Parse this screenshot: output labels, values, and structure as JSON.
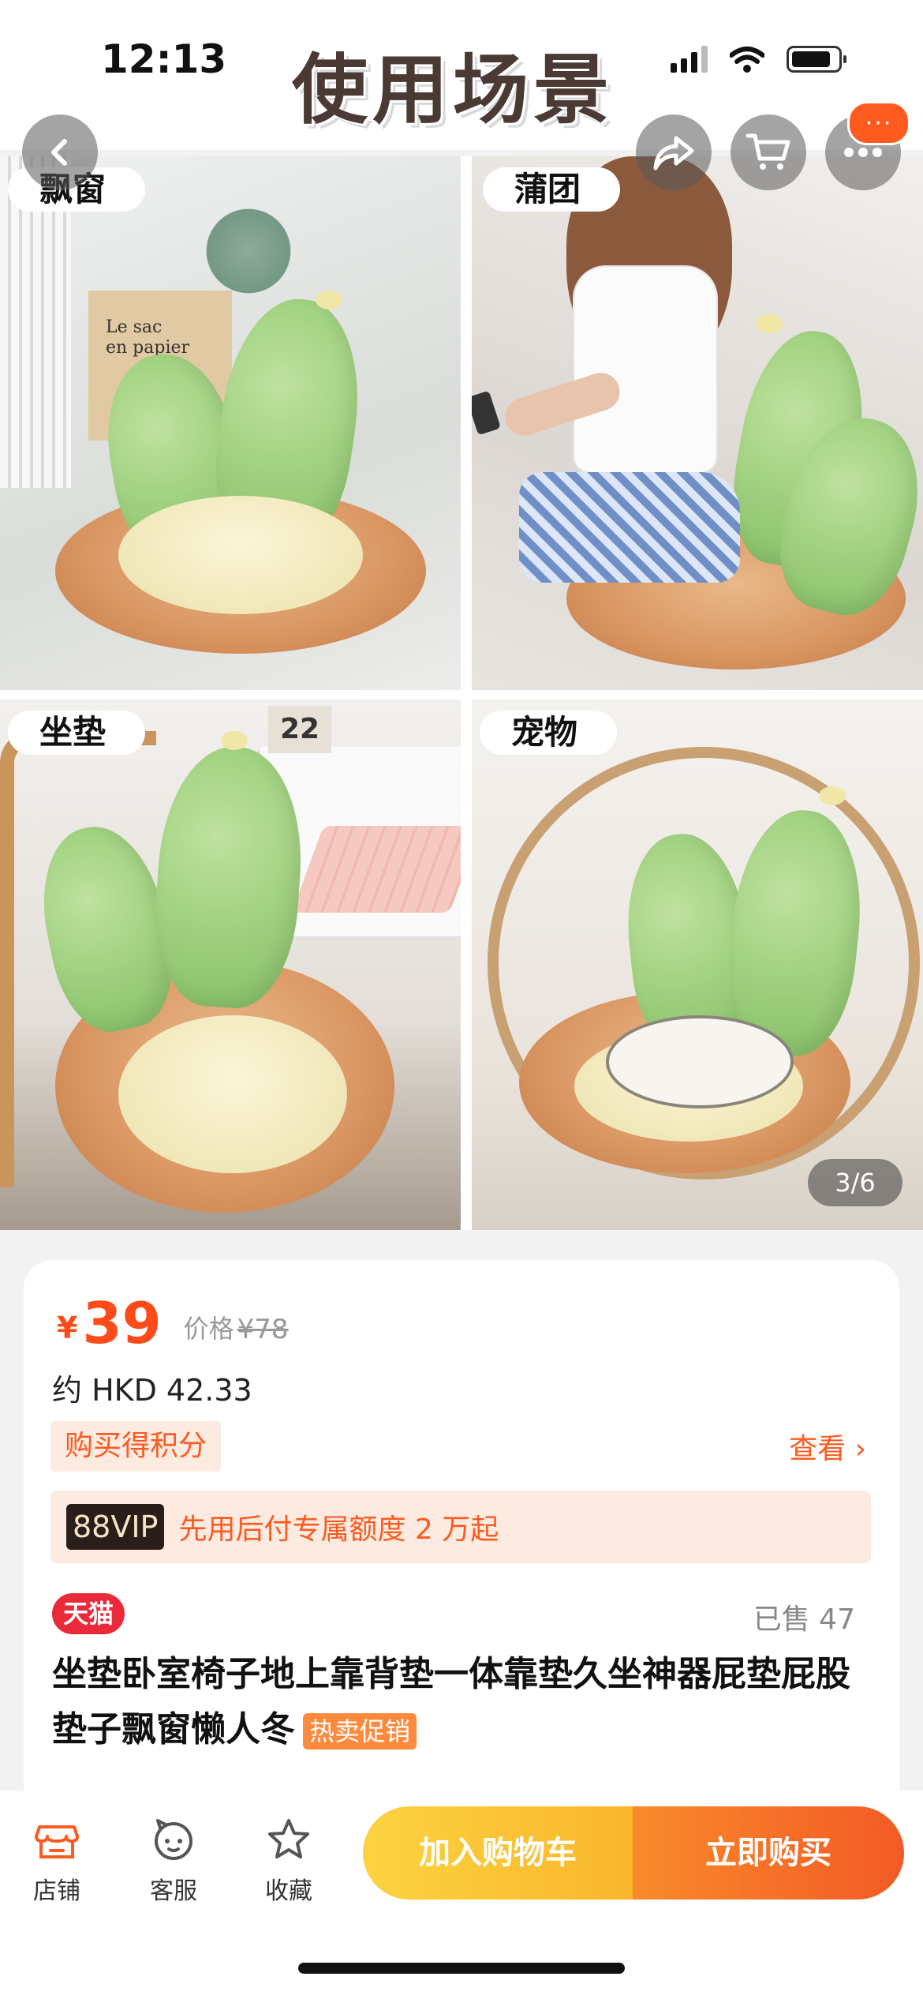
{
  "status_bar": {
    "time": "12:13"
  },
  "banner": {
    "title": "使用场景"
  },
  "nav": {
    "more_badge": "···"
  },
  "gallery": {
    "counter": "3/6",
    "tags": [
      "飘窗",
      "蒲团",
      "坐垫",
      "宠物"
    ],
    "bag_text": "Le sac\nen papier",
    "calendar_text": "22"
  },
  "product": {
    "currency": "¥",
    "price": "39",
    "orig_label": "价格",
    "orig_price": "¥78",
    "hkd": "约 HKD 42.33",
    "points_badge": "购买得积分",
    "view_link": "查看 ›",
    "vip_tag": "88VIP",
    "vip_text": "先用后付专属额度 2 万起",
    "store_badge": "天猫",
    "sold": "已售 47",
    "title": "坐垫卧室椅子地上靠背垫一体靠垫久坐神器屁垫屁股垫子飘窗懒人冬",
    "promo_tag": "热卖促销"
  },
  "bottom_bar": {
    "shop": "店铺",
    "service": "客服",
    "favorite": "收藏",
    "add_cart": "加入购物车",
    "buy_now": "立即购买"
  },
  "colors": {
    "accent": "#ff5a1f",
    "price": "#ff4b1a",
    "tmall": "#ea2a3a"
  }
}
